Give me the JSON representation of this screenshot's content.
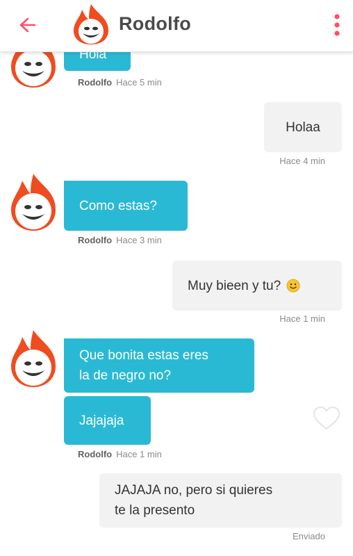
{
  "header": {
    "title": "Rodolfo"
  },
  "messages": [
    {
      "text": "Hola",
      "meta_name": "Rodolfo",
      "meta_time": "Hace 5 min"
    },
    {
      "text": "Holaa",
      "meta_time": "Hace 4 min"
    },
    {
      "text": "Como estas?",
      "meta_name": "Rodolfo",
      "meta_time": "Hace 3 min"
    },
    {
      "text": "Muy bieen y tu?",
      "meta_time": "Hace 1 min"
    },
    {
      "line1": "Que bonita estas eres",
      "line2": "la de negro no?"
    },
    {
      "text": "Jajajaja",
      "meta_name": "Rodolfo",
      "meta_time": "Hace 1 min"
    },
    {
      "line1": "JAJAJA no, pero si quieres",
      "line2": "te la presento",
      "status": "Enviado"
    }
  ],
  "colors": {
    "incoming": "#2ab9d4",
    "outgoing": "#f2f2f2",
    "accent": "#fd5068"
  }
}
